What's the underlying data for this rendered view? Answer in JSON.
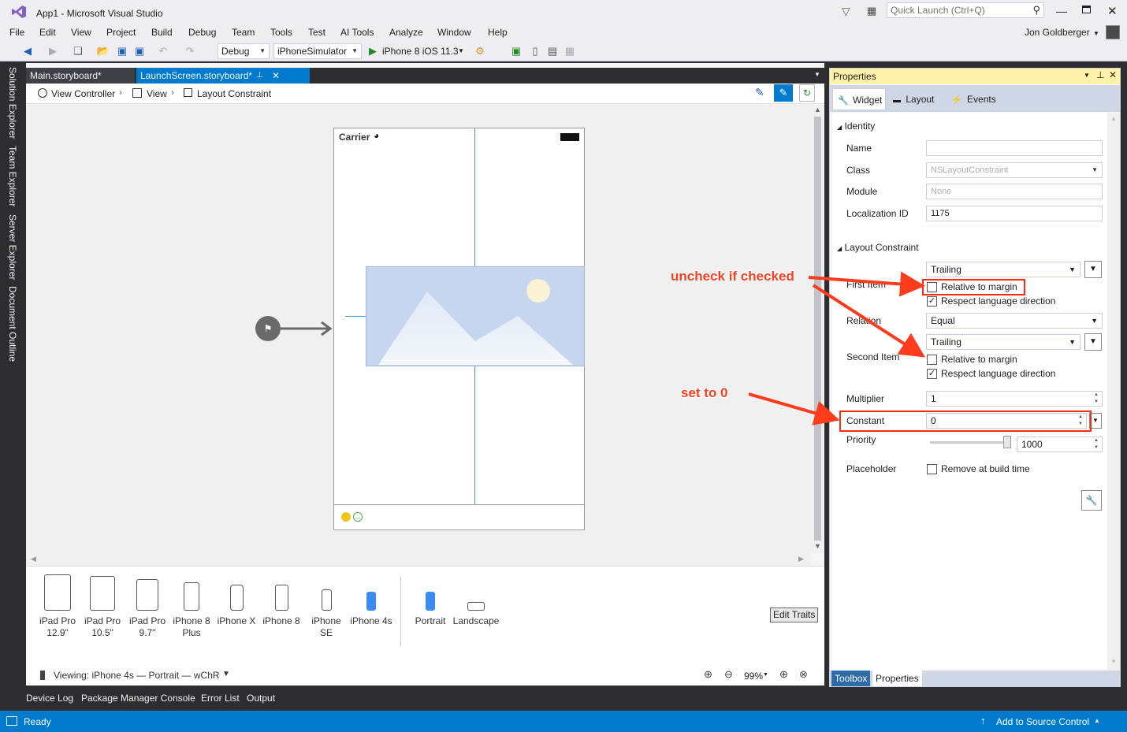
{
  "window": {
    "title": "App1 - Microsoft Visual Studio",
    "quick_launch_placeholder": "Quick Launch (Ctrl+Q)",
    "user": "Jon Goldberger"
  },
  "menu": [
    "File",
    "Edit",
    "View",
    "Project",
    "Build",
    "Debug",
    "Team",
    "Tools",
    "Test",
    "AI Tools",
    "Analyze",
    "Window",
    "Help"
  ],
  "toolbar": {
    "config": "Debug",
    "platform": "iPhoneSimulator",
    "run_target": "iPhone 8 iOS 11.3"
  },
  "side_tabs": [
    "Solution Explorer",
    "Team Explorer",
    "Server Explorer",
    "Document Outline"
  ],
  "doc_tabs": [
    "Main.storyboard*",
    "LaunchScreen.storyboard*"
  ],
  "breadcrumb": [
    "View Controller",
    "View",
    "Layout Constraint"
  ],
  "phone": {
    "carrier": "Carrier"
  },
  "devices": [
    {
      "line1": "iPad Pro",
      "line2": "12.9\""
    },
    {
      "line1": "iPad Pro",
      "line2": "10.5\""
    },
    {
      "line1": "iPad Pro",
      "line2": "9.7\""
    },
    {
      "line1": "iPhone 8",
      "line2": "Plus"
    },
    {
      "line1": "iPhone X",
      "line2": ""
    },
    {
      "line1": "iPhone 8",
      "line2": ""
    },
    {
      "line1": "iPhone SE",
      "line2": ""
    },
    {
      "line1": "iPhone 4s",
      "line2": ""
    }
  ],
  "orientations": [
    "Portrait",
    "Landscape"
  ],
  "edit_traits": "Edit Traits",
  "viewing": "Viewing: iPhone 4s — Portrait — wChR",
  "zoom": "99%",
  "bottom_tabs": [
    "Device Log",
    "Package Manager Console",
    "Error List",
    "Output"
  ],
  "status": {
    "left": "Ready",
    "right": "Add to Source Control"
  },
  "properties": {
    "header": "Properties",
    "tabs": [
      "Widget",
      "Layout",
      "Events"
    ],
    "identity_section": "Identity",
    "name_label": "Name",
    "name_value": "",
    "class_label": "Class",
    "class_value": "NSLayoutConstraint",
    "module_label": "Module",
    "module_value": "None",
    "localization_label": "Localization ID",
    "localization_value": "1175",
    "layout_section": "Layout Constraint",
    "first_item_label": "First Item",
    "first_item_value": "Trailing",
    "relative_to_margin": "Relative to margin",
    "respect_language": "Respect language direction",
    "relation_label": "Relation",
    "relation_value": "Equal",
    "second_item_label": "Second Item",
    "second_item_value": "Trailing",
    "multiplier_label": "Multiplier",
    "multiplier_value": "1",
    "constant_label": "Constant",
    "constant_value": "0",
    "priority_label": "Priority",
    "priority_value": "1000",
    "placeholder_label": "Placeholder",
    "remove_at_build": "Remove at build time",
    "bottom_tabs": [
      "Toolbox",
      "Properties"
    ]
  },
  "annotations": {
    "uncheck": "uncheck if checked",
    "set_zero": "set to 0"
  }
}
